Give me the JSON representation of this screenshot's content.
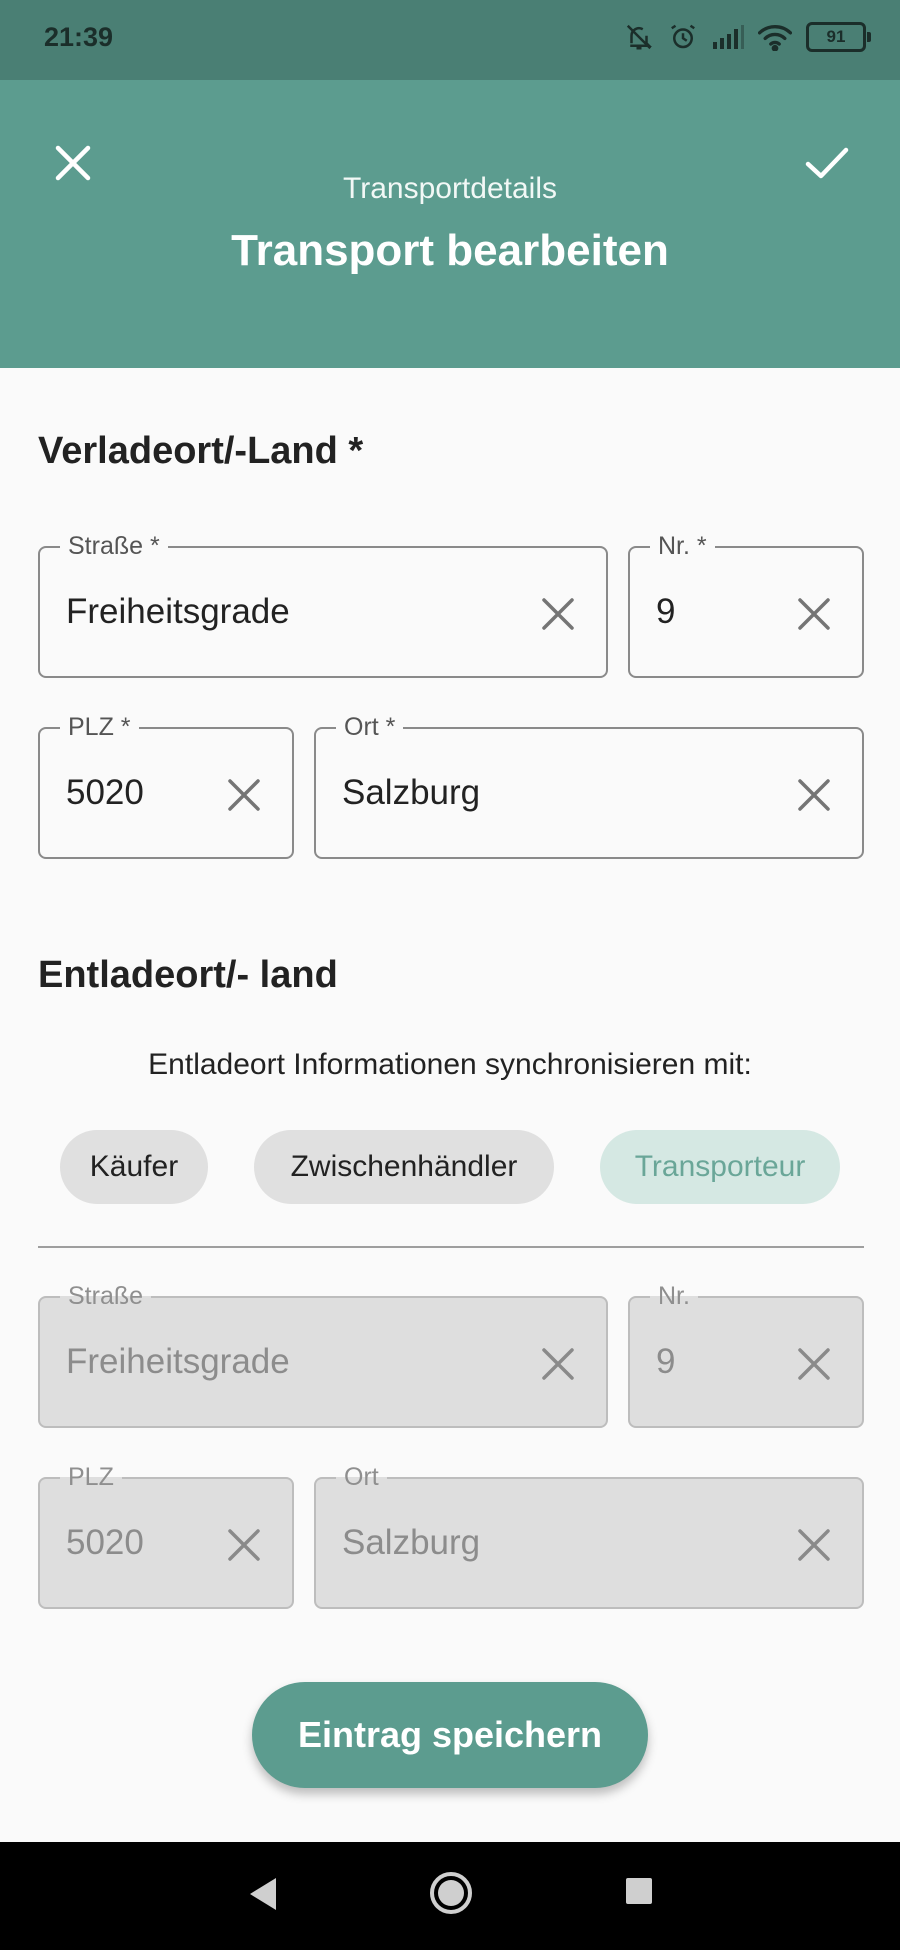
{
  "status_bar": {
    "time": "21:39",
    "battery": "91",
    "icons": [
      "bell-off-icon",
      "alarm-icon",
      "signal-icon",
      "wifi-icon",
      "battery-icon"
    ]
  },
  "app_bar": {
    "subtitle": "Transportdetails",
    "title": "Transport bearbeiten",
    "close_icon": "close-icon",
    "confirm_icon": "check-icon"
  },
  "loading": {
    "heading": "Verladeort/-Land *",
    "street": {
      "label": "Straße *",
      "value": "Freiheitsgrade"
    },
    "number": {
      "label": "Nr. *",
      "value": "9"
    },
    "zip": {
      "label": "PLZ *",
      "value": "5020"
    },
    "city": {
      "label": "Ort *",
      "value": "Salzburg"
    }
  },
  "unloading": {
    "heading": "Entladeort/- land",
    "sync_text": "Entladeort Informationen synchronisieren mit:",
    "chips": [
      {
        "label": "Käufer",
        "selected": false
      },
      {
        "label": "Zwischenhändler",
        "selected": false
      },
      {
        "label": "Transporteur",
        "selected": true
      }
    ],
    "street": {
      "label": "Straße",
      "value": "Freiheitsgrade"
    },
    "number": {
      "label": "Nr.",
      "value": "9"
    },
    "zip": {
      "label": "PLZ",
      "value": "5020"
    },
    "city": {
      "label": "Ort",
      "value": "Salzburg"
    }
  },
  "save_button": "Eintrag speichern",
  "nav_bar": [
    "back-icon",
    "home-icon",
    "recents-icon"
  ],
  "colors": {
    "primary": "#5c9c8f",
    "status_bar": "#4a7f74",
    "chip_selected_bg": "#d5e8e3",
    "chip_selected_text": "#6aa698"
  }
}
